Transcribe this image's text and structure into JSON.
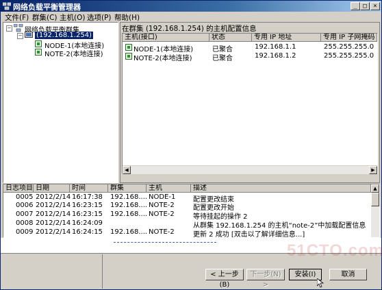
{
  "window": {
    "title": "网络负载平衡管理器"
  },
  "menu": [
    "文件(F)",
    "群集(C)",
    "主机(O)",
    "选项(P)",
    "帮助(H)"
  ],
  "tree": {
    "root": "网络负载平衡群集",
    "cluster": "(192.168.1.254)",
    "nodes": [
      "NODE-1(本地连接)",
      "NOTE-2(本地连接)"
    ]
  },
  "right_panel": {
    "heading": "在群集  (192.168.1.254) 的主机配置信息",
    "columns": [
      "主机(接口)",
      "状态",
      "专用 IP 地址",
      "专用 IP 子网掩码"
    ],
    "rows": [
      [
        "NODE-1(本地连接)",
        "已聚合",
        "192.168.1.1",
        "255.255.255.0"
      ],
      [
        "NOTE-2(本地连接)",
        "已聚合",
        "192.168.1.2",
        "255.255.255.0"
      ]
    ]
  },
  "log": {
    "columns": [
      "日志项目",
      "日期",
      "时间",
      "群集",
      "主机",
      "描述"
    ],
    "rows": [
      [
        "0005",
        "2012/2/14",
        "16:17:38",
        "192.168....",
        "NODE-1",
        "配置更改结束"
      ],
      [
        "0006",
        "2012/2/14",
        "16:23:15",
        "192.168....",
        "NOTE-2",
        "配置更改开始"
      ],
      [
        "0007",
        "2012/2/14",
        "16:23:15",
        "192.168....",
        "NOTE-2",
        "等待挂起的操作 2"
      ],
      [
        "0008",
        "2012/2/14",
        "16:24:09",
        "",
        "",
        "从群集 192.168.1.254 的主机“note-2”中加载配置信息"
      ],
      [
        "0009",
        "2012/2/14",
        "16:24:15",
        "192.168....",
        "NOTE-2",
        "更新 2 成功 [双击以了解详细信息...]"
      ]
    ]
  },
  "wizard": {
    "back": "< 上一步(B)",
    "next": "下一步(N) >",
    "install": "安装(I)",
    "cancel": "取消"
  },
  "watermark": "51CTO.com",
  "colors": {
    "titlebar": "#0a246a",
    "selection": "#0a246a",
    "nic_icon": "#2f8f2f"
  }
}
